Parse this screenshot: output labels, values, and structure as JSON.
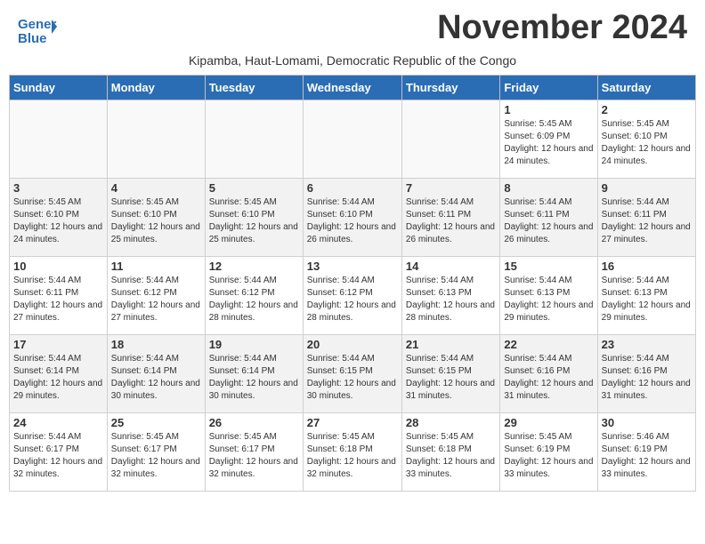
{
  "header": {
    "logo_line1": "General",
    "logo_line2": "Blue",
    "month_title": "November 2024",
    "subtitle": "Kipamba, Haut-Lomami, Democratic Republic of the Congo"
  },
  "weekdays": [
    "Sunday",
    "Monday",
    "Tuesday",
    "Wednesday",
    "Thursday",
    "Friday",
    "Saturday"
  ],
  "weeks": [
    [
      {
        "day": "",
        "info": "",
        "empty": true
      },
      {
        "day": "",
        "info": "",
        "empty": true
      },
      {
        "day": "",
        "info": "",
        "empty": true
      },
      {
        "day": "",
        "info": "",
        "empty": true
      },
      {
        "day": "",
        "info": "",
        "empty": true
      },
      {
        "day": "1",
        "info": "Sunrise: 5:45 AM\nSunset: 6:09 PM\nDaylight: 12 hours and 24 minutes.",
        "empty": false
      },
      {
        "day": "2",
        "info": "Sunrise: 5:45 AM\nSunset: 6:10 PM\nDaylight: 12 hours and 24 minutes.",
        "empty": false
      }
    ],
    [
      {
        "day": "3",
        "info": "Sunrise: 5:45 AM\nSunset: 6:10 PM\nDaylight: 12 hours and 24 minutes.",
        "empty": false
      },
      {
        "day": "4",
        "info": "Sunrise: 5:45 AM\nSunset: 6:10 PM\nDaylight: 12 hours and 25 minutes.",
        "empty": false
      },
      {
        "day": "5",
        "info": "Sunrise: 5:45 AM\nSunset: 6:10 PM\nDaylight: 12 hours and 25 minutes.",
        "empty": false
      },
      {
        "day": "6",
        "info": "Sunrise: 5:44 AM\nSunset: 6:10 PM\nDaylight: 12 hours and 26 minutes.",
        "empty": false
      },
      {
        "day": "7",
        "info": "Sunrise: 5:44 AM\nSunset: 6:11 PM\nDaylight: 12 hours and 26 minutes.",
        "empty": false
      },
      {
        "day": "8",
        "info": "Sunrise: 5:44 AM\nSunset: 6:11 PM\nDaylight: 12 hours and 26 minutes.",
        "empty": false
      },
      {
        "day": "9",
        "info": "Sunrise: 5:44 AM\nSunset: 6:11 PM\nDaylight: 12 hours and 27 minutes.",
        "empty": false
      }
    ],
    [
      {
        "day": "10",
        "info": "Sunrise: 5:44 AM\nSunset: 6:11 PM\nDaylight: 12 hours and 27 minutes.",
        "empty": false
      },
      {
        "day": "11",
        "info": "Sunrise: 5:44 AM\nSunset: 6:12 PM\nDaylight: 12 hours and 27 minutes.",
        "empty": false
      },
      {
        "day": "12",
        "info": "Sunrise: 5:44 AM\nSunset: 6:12 PM\nDaylight: 12 hours and 28 minutes.",
        "empty": false
      },
      {
        "day": "13",
        "info": "Sunrise: 5:44 AM\nSunset: 6:12 PM\nDaylight: 12 hours and 28 minutes.",
        "empty": false
      },
      {
        "day": "14",
        "info": "Sunrise: 5:44 AM\nSunset: 6:13 PM\nDaylight: 12 hours and 28 minutes.",
        "empty": false
      },
      {
        "day": "15",
        "info": "Sunrise: 5:44 AM\nSunset: 6:13 PM\nDaylight: 12 hours and 29 minutes.",
        "empty": false
      },
      {
        "day": "16",
        "info": "Sunrise: 5:44 AM\nSunset: 6:13 PM\nDaylight: 12 hours and 29 minutes.",
        "empty": false
      }
    ],
    [
      {
        "day": "17",
        "info": "Sunrise: 5:44 AM\nSunset: 6:14 PM\nDaylight: 12 hours and 29 minutes.",
        "empty": false
      },
      {
        "day": "18",
        "info": "Sunrise: 5:44 AM\nSunset: 6:14 PM\nDaylight: 12 hours and 30 minutes.",
        "empty": false
      },
      {
        "day": "19",
        "info": "Sunrise: 5:44 AM\nSunset: 6:14 PM\nDaylight: 12 hours and 30 minutes.",
        "empty": false
      },
      {
        "day": "20",
        "info": "Sunrise: 5:44 AM\nSunset: 6:15 PM\nDaylight: 12 hours and 30 minutes.",
        "empty": false
      },
      {
        "day": "21",
        "info": "Sunrise: 5:44 AM\nSunset: 6:15 PM\nDaylight: 12 hours and 31 minutes.",
        "empty": false
      },
      {
        "day": "22",
        "info": "Sunrise: 5:44 AM\nSunset: 6:16 PM\nDaylight: 12 hours and 31 minutes.",
        "empty": false
      },
      {
        "day": "23",
        "info": "Sunrise: 5:44 AM\nSunset: 6:16 PM\nDaylight: 12 hours and 31 minutes.",
        "empty": false
      }
    ],
    [
      {
        "day": "24",
        "info": "Sunrise: 5:44 AM\nSunset: 6:17 PM\nDaylight: 12 hours and 32 minutes.",
        "empty": false
      },
      {
        "day": "25",
        "info": "Sunrise: 5:45 AM\nSunset: 6:17 PM\nDaylight: 12 hours and 32 minutes.",
        "empty": false
      },
      {
        "day": "26",
        "info": "Sunrise: 5:45 AM\nSunset: 6:17 PM\nDaylight: 12 hours and 32 minutes.",
        "empty": false
      },
      {
        "day": "27",
        "info": "Sunrise: 5:45 AM\nSunset: 6:18 PM\nDaylight: 12 hours and 32 minutes.",
        "empty": false
      },
      {
        "day": "28",
        "info": "Sunrise: 5:45 AM\nSunset: 6:18 PM\nDaylight: 12 hours and 33 minutes.",
        "empty": false
      },
      {
        "day": "29",
        "info": "Sunrise: 5:45 AM\nSunset: 6:19 PM\nDaylight: 12 hours and 33 minutes.",
        "empty": false
      },
      {
        "day": "30",
        "info": "Sunrise: 5:46 AM\nSunset: 6:19 PM\nDaylight: 12 hours and 33 minutes.",
        "empty": false
      }
    ]
  ]
}
